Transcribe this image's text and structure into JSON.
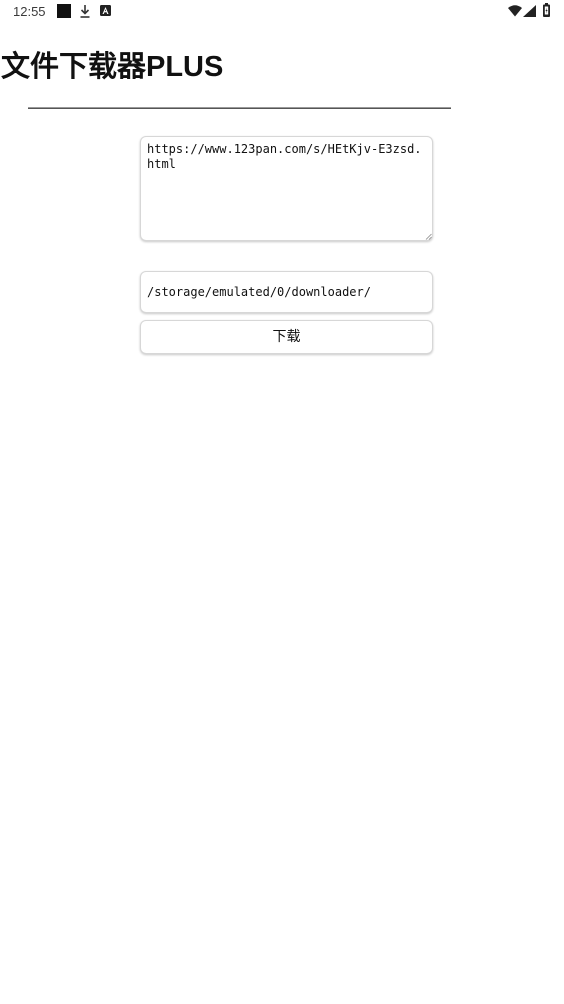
{
  "status_bar": {
    "time": "12:55",
    "icons": [
      "stop-square-icon",
      "download-icon",
      "a-icon",
      "wifi-icon",
      "signal-icon",
      "battery-icon"
    ]
  },
  "app": {
    "title": "文件下载器PLUS"
  },
  "form": {
    "url_value": "https://www.123pan.com/s/HEtKjv-E3zsd.html",
    "path_value": "/storage/emulated/0/downloader/",
    "download_label": "下载"
  },
  "colors": {
    "background": "#ffffff",
    "text": "#111111",
    "border": "#d7d7d7",
    "divider": "#555555"
  }
}
